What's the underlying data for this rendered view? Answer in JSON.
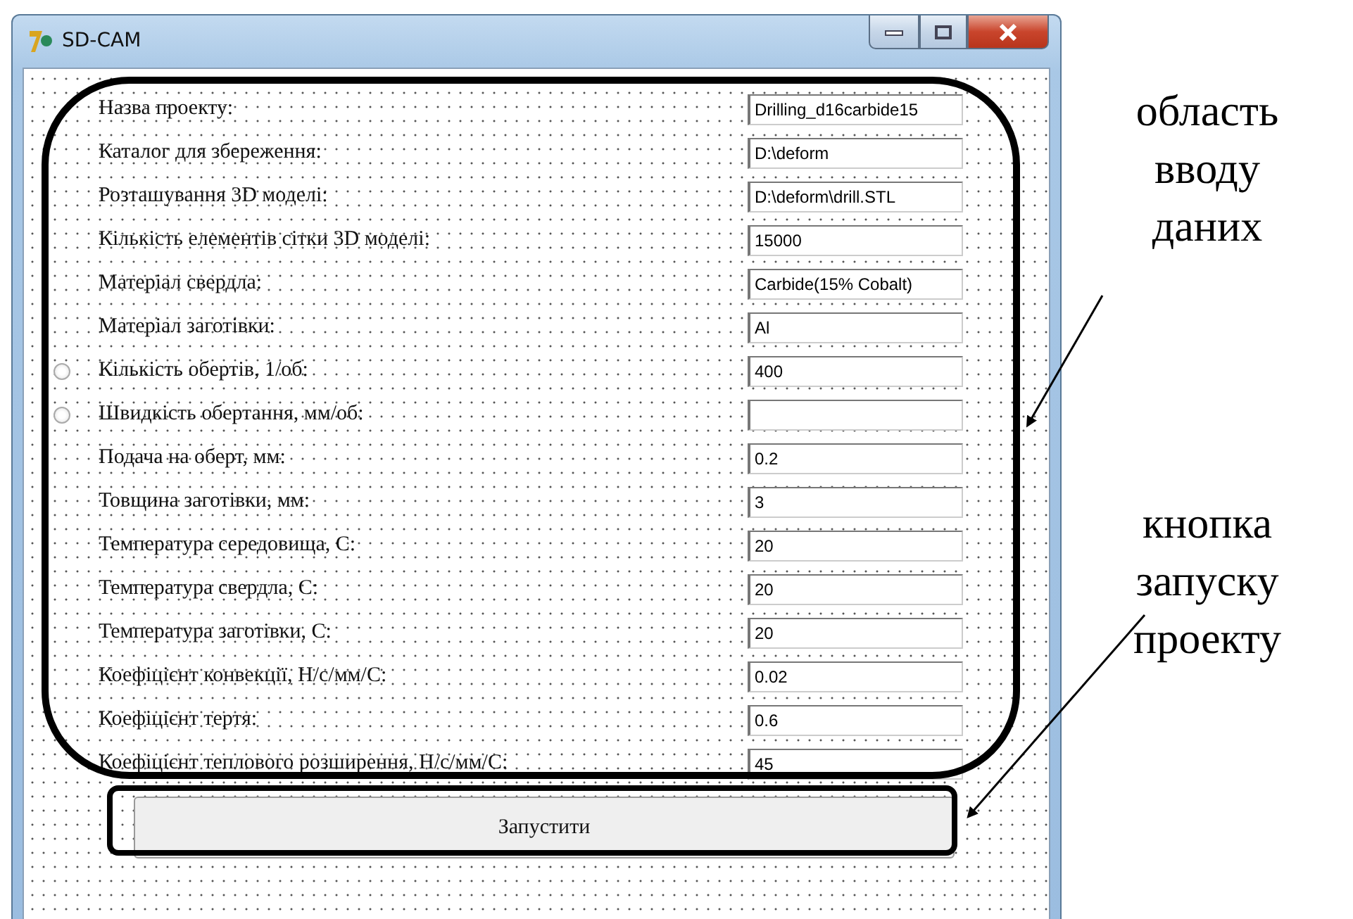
{
  "window": {
    "title": "SD-CAM"
  },
  "fields": [
    {
      "label": "Назва проекту:",
      "value": "Drilling_d16carbide15"
    },
    {
      "label": "Каталог для збереження:",
      "value": "D:\\deform"
    },
    {
      "label": "Розташування 3D моделі:",
      "value": "D:\\deform\\drill.STL"
    },
    {
      "label": "Кількість елементів сітки 3D моделі:",
      "value": "15000"
    },
    {
      "label": "Матеріал свердла:",
      "value": "Carbide(15% Cobalt)"
    },
    {
      "label": "Матеріал заготівки:",
      "value": "Al"
    },
    {
      "label": "Кількість обертів, 1/об:",
      "value": "400",
      "radio": {
        "selected": false
      }
    },
    {
      "label": "Швидкість обертання, мм/об:",
      "radio": {
        "selected": false
      }
    },
    {
      "label": "Подача на оберт, мм:",
      "value": "0.2"
    },
    {
      "label": "Товщина заготівки, мм:",
      "value": "3"
    },
    {
      "label": "Температура середовища, С:",
      "value": "20"
    },
    {
      "label": "Температура свердла, С:",
      "value": "20"
    },
    {
      "label": "Температура заготівки, С:",
      "value": "20"
    },
    {
      "label": "Коефіцієнт конвекції, Н/с/мм/С:",
      "value": "0.02"
    },
    {
      "label": "Коефіцієнт тертя:",
      "value": "0.6"
    },
    {
      "label": "Коефіцієнт теплового розширення, Н/с/мм/С:",
      "value": "45"
    }
  ],
  "run_button": {
    "label": "Запустити"
  },
  "annotations": [
    {
      "text": "область вводу даних"
    },
    {
      "text": "кнопка запуску проекту"
    }
  ]
}
